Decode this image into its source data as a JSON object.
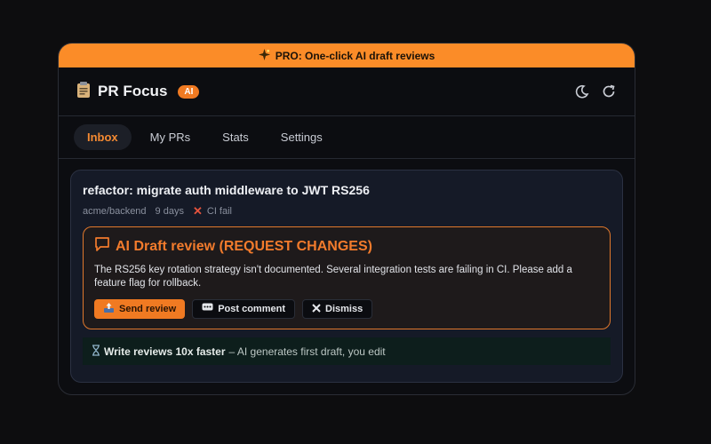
{
  "promo": {
    "icon": "sparkle-icon",
    "text": "PRO: One-click AI draft reviews"
  },
  "header": {
    "logo_icon": "clipboard-icon",
    "title": "PR Focus",
    "badge": "AI",
    "actions": [
      "moon-icon",
      "refresh-icon"
    ]
  },
  "tabs": [
    {
      "label": "Inbox",
      "active": true
    },
    {
      "label": "My PRs",
      "active": false
    },
    {
      "label": "Stats",
      "active": false
    },
    {
      "label": "Settings",
      "active": false
    }
  ],
  "pr": {
    "title": "refactor: migrate auth middleware to JWT RS256",
    "repo": "acme/backend",
    "age": "9 days",
    "ci_status": "CI fail",
    "ci_icon": "x-icon"
  },
  "draft": {
    "icon": "comment-icon",
    "title": "AI Draft review (REQUEST CHANGES)",
    "body": "The RS256 key rotation strategy isn't documented. Several integration tests are failing in CI. Please add a feature flag for rollback.",
    "buttons": {
      "send": "Send review",
      "comment": "Post comment",
      "dismiss": "Dismiss"
    }
  },
  "tip": {
    "icon": "hourglass-icon",
    "strong": "Write reviews 10x faster",
    "rest": "– AI generates first draft, you edit"
  },
  "colors": {
    "accent": "#f07a22",
    "promo_bg": "#fb8c28",
    "fail": "#e5533d"
  }
}
